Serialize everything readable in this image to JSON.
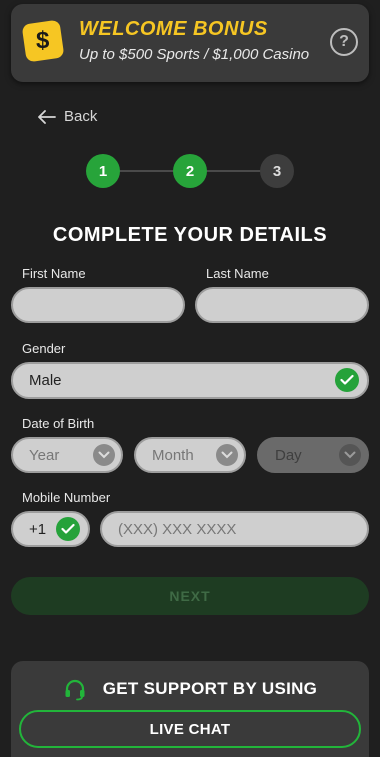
{
  "banner": {
    "title": "WELCOME BONUS",
    "subtitle": "Up to $500 Sports / $1,000 Casino",
    "icon_glyph": "$",
    "help_glyph": "?",
    "accent_color": "#f6c623"
  },
  "nav": {
    "back_label": "Back"
  },
  "steps": {
    "items": [
      {
        "label": "1",
        "state": "complete"
      },
      {
        "label": "2",
        "state": "complete"
      },
      {
        "label": "3",
        "state": "pending"
      }
    ],
    "complete_color": "#27a43a"
  },
  "page_title": "COMPLETE YOUR DETAILS",
  "form": {
    "first_name": {
      "label": "First Name",
      "value": ""
    },
    "last_name": {
      "label": "Last Name",
      "value": ""
    },
    "gender": {
      "label": "Gender",
      "value": "Male"
    },
    "dob": {
      "label": "Date of Birth",
      "year_placeholder": "Year",
      "month_placeholder": "Month",
      "day_placeholder": "Day"
    },
    "mobile": {
      "label": "Mobile Number",
      "country_code": "+1",
      "placeholder": "(XXX) XXX XXXX"
    }
  },
  "next_label": "NEXT",
  "support": {
    "title": "GET SUPPORT BY USING",
    "live_chat_label": "LIVE CHAT"
  },
  "icons": {
    "banner": "dollar-icon",
    "help": "question-icon",
    "back": "arrow-left-icon",
    "check": "check-icon",
    "dropdown": "chevron-down-icon",
    "support": "headset-icon"
  }
}
